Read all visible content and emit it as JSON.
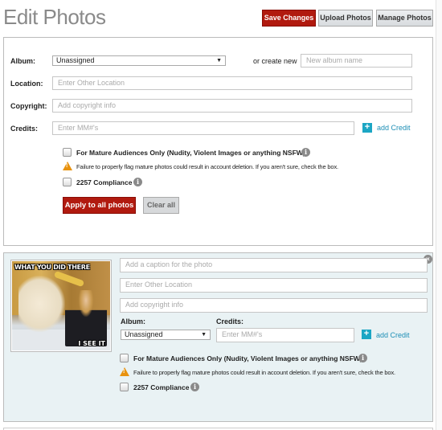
{
  "header": {
    "title": "Edit Photos",
    "buttons": {
      "save": "Save Changes",
      "upload": "Upload Photos",
      "manage": "Manage Photos"
    }
  },
  "bulk": {
    "album_label": "Album:",
    "album_value": "Unassigned",
    "create_new_label": "or create new",
    "new_album_placeholder": "New album name",
    "location_label": "Location:",
    "location_placeholder": "Enter Other Location",
    "copyright_label": "Copyright:",
    "copyright_placeholder": "Add copyright info",
    "credits_label": "Credits:",
    "credits_placeholder": "Enter MM#'s",
    "add_credit": "add Credit",
    "mature_label": "For Mature Audiences Only (Nudity, Violent Images or anything NSFW)",
    "warning": "Failure to properly flag mature photos could result in account deletion. If you aren't sure, check the box.",
    "compliance_label": "2257 Compliance",
    "apply_all": "Apply to all photos",
    "clear_all": "Clear all"
  },
  "photo": {
    "meme_top": "WHAT YOU DID THERE",
    "meme_bottom": "I SEE IT",
    "caption_placeholder": "Add a caption for the photo",
    "location_placeholder": "Enter Other Location",
    "copyright_placeholder": "Add copyright info",
    "album_label": "Album:",
    "album_value": "Unassigned",
    "credits_label": "Credits:",
    "credits_placeholder": "Enter MM#'s",
    "add_credit": "add Credit",
    "mature_label": "For Mature Audiences Only (Nudity, Violent Images or anything NSFW)",
    "warning": "Failure to properly flag mature photos could result in account deletion. If you aren't sure, check the box.",
    "compliance_label": "2257 Compliance"
  },
  "icons": {
    "plus": "+",
    "info": "i",
    "warning": "!",
    "close": "×",
    "dropdown": "▼"
  },
  "colors": {
    "primary_red": "#b11a0f",
    "accent_teal": "#1ca6c4",
    "link_blue": "#1e8fb6",
    "warning_orange": "#e8920e",
    "photo_panel_bg": "#e9f2f4"
  }
}
